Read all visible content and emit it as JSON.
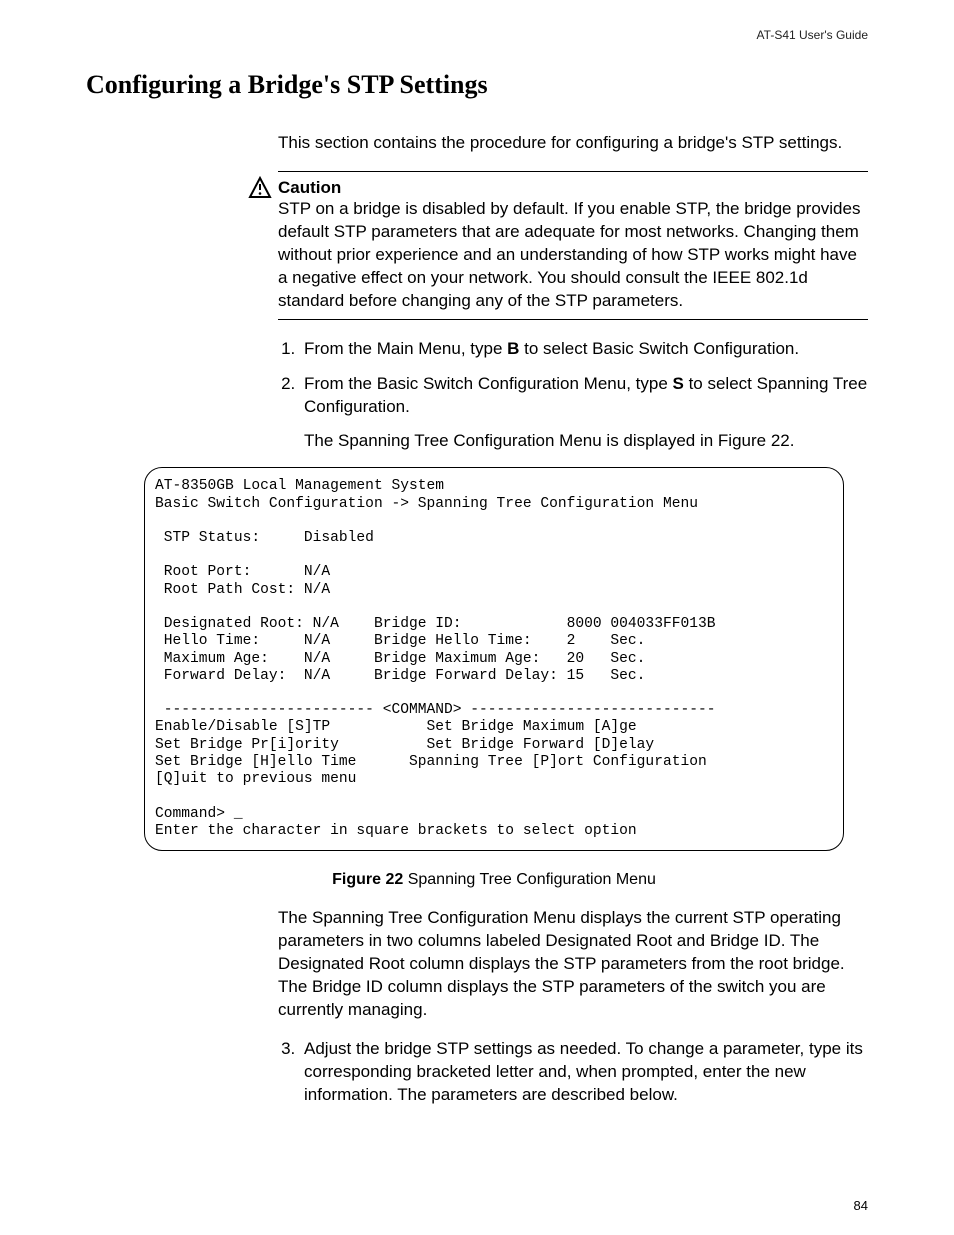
{
  "runningHead": "AT-S41 User's Guide",
  "title": "Configuring a Bridge's STP Settings",
  "intro": "This section contains the procedure for configuring a bridge's STP settings.",
  "caution": {
    "label": "Caution",
    "text": "STP on a bridge is disabled by default. If you enable STP, the bridge provides default STP parameters that are adequate for most networks. Changing them without prior experience and an understanding of how STP works might have a negative effect on your network. You should consult the IEEE 802.1d standard before changing any of the STP parameters."
  },
  "steps": {
    "s1_pre": "From the Main Menu, type ",
    "s1_b": "B",
    "s1_post": " to select Basic Switch Configuration.",
    "s2_pre": "From the Basic Switch Configuration Menu, type ",
    "s2_b": "S",
    "s2_post": " to select Spanning Tree Configuration.",
    "s2_tail": "The Spanning Tree Configuration Menu is displayed in Figure 22.",
    "s3": "Adjust the bridge STP settings as needed. To change a parameter, type its corresponding bracketed letter and, when prompted, enter the new information. The parameters are described below."
  },
  "terminalText": "AT-8350GB Local Management System\nBasic Switch Configuration -> Spanning Tree Configuration Menu\n\n STP Status:     Disabled\n\n Root Port:      N/A\n Root Path Cost: N/A\n\n Designated Root: N/A    Bridge ID:            8000 004033FF013B\n Hello Time:     N/A     Bridge Hello Time:    2    Sec.\n Maximum Age:    N/A     Bridge Maximum Age:   20   Sec.\n Forward Delay:  N/A     Bridge Forward Delay: 15   Sec.\n\n ------------------------ <COMMAND> ----------------------------\nEnable/Disable [S]TP           Set Bridge Maximum [A]ge\nSet Bridge Pr[i]ority          Set Bridge Forward [D]elay\nSet Bridge [H]ello Time      Spanning Tree [P]ort Configuration\n[Q]uit to previous menu\n\nCommand> _\nEnter the character in square brackets to select option",
  "figureCaption": {
    "bold": "Figure 22",
    "rest": "  Spanning Tree Configuration Menu"
  },
  "afterFigure": "The Spanning Tree Configuration Menu displays the current STP operating parameters in two columns labeled Designated Root and Bridge ID. The Designated Root column displays the STP parameters from the root bridge. The Bridge ID column displays the STP parameters of the switch you are currently managing.",
  "pageNumber": "84"
}
